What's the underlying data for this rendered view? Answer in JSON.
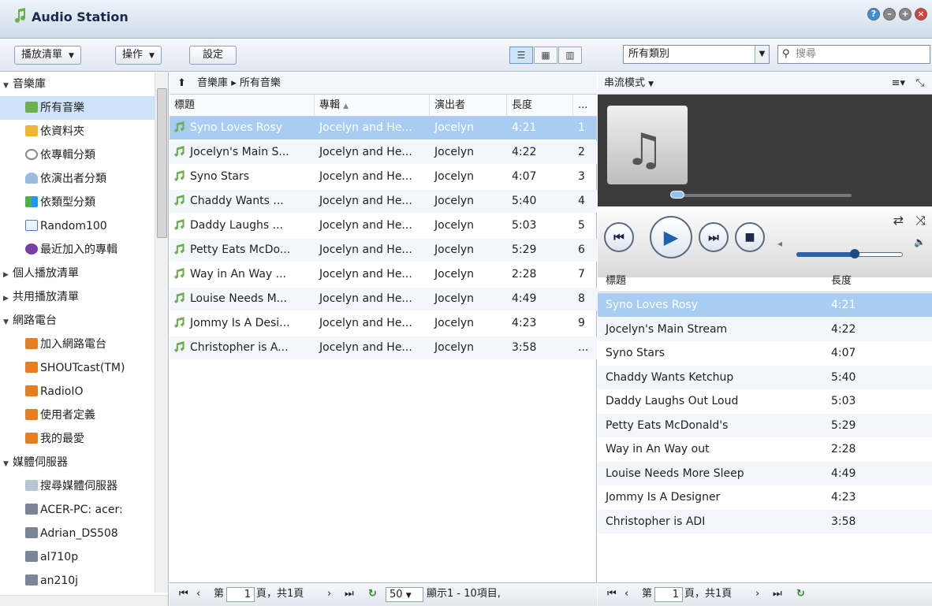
{
  "app": {
    "title": "Audio Station"
  },
  "toolbar": {
    "playlist": "播放清單",
    "actions": "操作",
    "settings": "設定",
    "category": "所有類別",
    "search_placeholder": "搜尋"
  },
  "sidebar": {
    "items": [
      {
        "label": "音樂庫",
        "icon": "collapse-triangle"
      },
      {
        "label": "所有音樂",
        "icon": "music-note-icon"
      },
      {
        "label": "依資料夾",
        "icon": "folder-icon"
      },
      {
        "label": "依專輯分類",
        "icon": "disc-icon"
      },
      {
        "label": "依演出者分類",
        "icon": "person-icon"
      },
      {
        "label": "依類型分類",
        "icon": "genre-grid-icon"
      },
      {
        "label": "Random100",
        "icon": "random100-icon"
      },
      {
        "label": "最近加入的專輯",
        "icon": "new-album-icon"
      },
      {
        "label": "個人播放清單",
        "icon": "expand-triangle"
      },
      {
        "label": "共用播放清單",
        "icon": "expand-triangle"
      },
      {
        "label": "網路電台",
        "icon": "collapse-triangle"
      },
      {
        "label": "加入網路電台",
        "icon": "add-radio-icon"
      },
      {
        "label": "SHOUTcast(TM)",
        "icon": "radio-tower-icon"
      },
      {
        "label": "RadioIO",
        "icon": "radio-tower-icon"
      },
      {
        "label": "使用者定義",
        "icon": "radio-tower-icon"
      },
      {
        "label": "我的最愛",
        "icon": "radio-tower-icon"
      },
      {
        "label": "媒體伺服器",
        "icon": "collapse-triangle"
      },
      {
        "label": "搜尋媒體伺服器",
        "icon": "server-search-icon"
      },
      {
        "label": "ACER-PC: acer:",
        "icon": "media-server-icon"
      },
      {
        "label": "Adrian_DS508",
        "icon": "media-server-icon"
      },
      {
        "label": "al710p",
        "icon": "media-server-icon"
      },
      {
        "label": "an210j",
        "icon": "media-server-icon"
      }
    ]
  },
  "breadcrumb": {
    "root": "音樂庫",
    "sep": "▸",
    "current": "所有音樂"
  },
  "table": {
    "headers": {
      "title": "標題",
      "album": "專輯",
      "sort_mark": "▲",
      "artist": "演出者",
      "length": "長度",
      "more": "..."
    },
    "rows": [
      {
        "title": "Syno Loves Rosy",
        "album": "Jocelyn and He...",
        "artist": "Jocelyn",
        "length": "4:21",
        "num": "1"
      },
      {
        "title": "Jocelyn's Main S...",
        "album": "Jocelyn and He...",
        "artist": "Jocelyn",
        "length": "4:22",
        "num": "2"
      },
      {
        "title": "Syno Stars",
        "album": "Jocelyn and He...",
        "artist": "Jocelyn",
        "length": "4:07",
        "num": "3"
      },
      {
        "title": "Chaddy Wants ...",
        "album": "Jocelyn and He...",
        "artist": "Jocelyn",
        "length": "5:40",
        "num": "4"
      },
      {
        "title": "Daddy Laughs ...",
        "album": "Jocelyn and He...",
        "artist": "Jocelyn",
        "length": "5:03",
        "num": "5"
      },
      {
        "title": "Petty Eats McDo...",
        "album": "Jocelyn and He...",
        "artist": "Jocelyn",
        "length": "5:29",
        "num": "6"
      },
      {
        "title": "Way in An Way ...",
        "album": "Jocelyn and He...",
        "artist": "Jocelyn",
        "length": "2:28",
        "num": "7"
      },
      {
        "title": "Louise Needs M...",
        "album": "Jocelyn and He...",
        "artist": "Jocelyn",
        "length": "4:49",
        "num": "8"
      },
      {
        "title": "Jommy Is A Desi...",
        "album": "Jocelyn and He...",
        "artist": "Jocelyn",
        "length": "4:23",
        "num": "9"
      },
      {
        "title": "Christopher is A...",
        "album": "Jocelyn and He...",
        "artist": "Jocelyn",
        "length": "3:58",
        "num": "..."
      }
    ]
  },
  "pager": {
    "page_prefix": "第",
    "page": "1",
    "page_suffix": "頁，共1頁",
    "per_page": "50",
    "display": "顯示1 - 10項目,"
  },
  "player": {
    "mode": "串流模式",
    "headers": {
      "title": "標題",
      "length": "長度"
    },
    "volume": 0.55,
    "rows": [
      {
        "title": "Syno Loves Rosy",
        "length": "4:21"
      },
      {
        "title": "Jocelyn's Main Stream",
        "length": "4:22"
      },
      {
        "title": "Syno Stars",
        "length": "4:07"
      },
      {
        "title": "Chaddy Wants Ketchup",
        "length": "5:40"
      },
      {
        "title": "Daddy Laughs Out Loud",
        "length": "5:03"
      },
      {
        "title": "Petty Eats McDonald's",
        "length": "5:29"
      },
      {
        "title": "Way in An Way out",
        "length": "2:28"
      },
      {
        "title": "Louise Needs More Sleep",
        "length": "4:49"
      },
      {
        "title": "Jommy Is A Designer",
        "length": "4:23"
      },
      {
        "title": "Christopher is ADI",
        "length": "3:58"
      }
    ]
  },
  "colors": {
    "accent": "#a9cdf2",
    "selection_text": "#ffffff",
    "note_green": "#6ab04c"
  }
}
